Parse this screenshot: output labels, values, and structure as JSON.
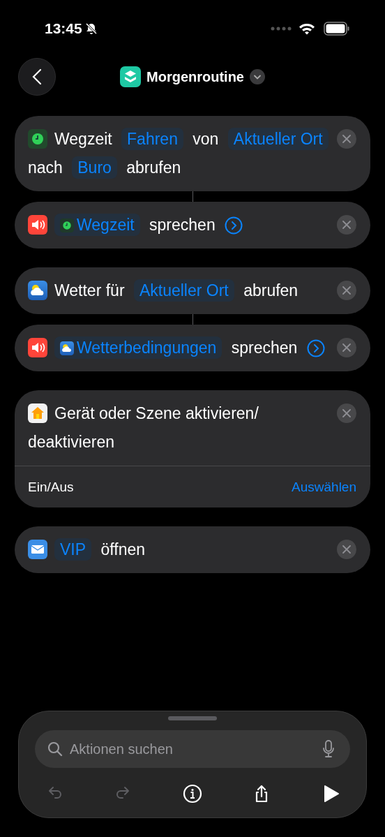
{
  "status_bar": {
    "time": "13:45"
  },
  "header": {
    "title": "Morgenroutine"
  },
  "action_groups": [
    [
      {
        "kind": "clock",
        "parts": [
          {
            "kind": "text",
            "text": "Wegzeit"
          },
          {
            "kind": "token",
            "text": "Fahren"
          },
          {
            "kind": "text",
            "text": "von"
          },
          {
            "kind": "token",
            "text": "Aktueller Ort"
          },
          {
            "kind": "text",
            "text": "nach"
          },
          {
            "kind": "token",
            "text": "Buro"
          },
          {
            "kind": "text",
            "text": "abrufen"
          }
        ]
      },
      {
        "kind": "speaker",
        "parts": [
          {
            "kind": "clock_token",
            "text": "Wegzeit"
          },
          {
            "kind": "text",
            "text": "sprechen"
          },
          {
            "kind": "more"
          }
        ]
      }
    ],
    [
      {
        "kind": "weather",
        "parts": [
          {
            "kind": "text",
            "text": "Wetter für"
          },
          {
            "kind": "token",
            "text": "Aktueller Ort"
          },
          {
            "kind": "text",
            "text": "abrufen"
          }
        ]
      },
      {
        "kind": "speaker",
        "parts": [
          {
            "kind": "weather_token",
            "text": "Wetterbedingungen"
          },
          {
            "kind": "text",
            "text": "sprechen"
          },
          {
            "kind": "more"
          }
        ]
      }
    ],
    [
      {
        "kind": "home",
        "parts": [
          {
            "kind": "text",
            "text": "Gerät oder Szene aktivieren/"
          },
          {
            "kind": "text",
            "text": "deaktivieren"
          }
        ],
        "parameter": {
          "label": "Ein/Aus",
          "value": "Auswählen"
        }
      }
    ],
    [
      {
        "kind": "mail",
        "parts": [
          {
            "kind": "token",
            "text": "VIP"
          },
          {
            "kind": "text",
            "text": "öffnen"
          }
        ]
      }
    ]
  ],
  "search": {
    "placeholder": "Aktionen suchen"
  },
  "toolbar": [
    {
      "kind": "undo",
      "disabled": true
    },
    {
      "kind": "redo",
      "disabled": true
    },
    {
      "kind": "info",
      "disabled": false
    },
    {
      "kind": "share",
      "disabled": false
    },
    {
      "kind": "run",
      "disabled": false
    }
  ]
}
